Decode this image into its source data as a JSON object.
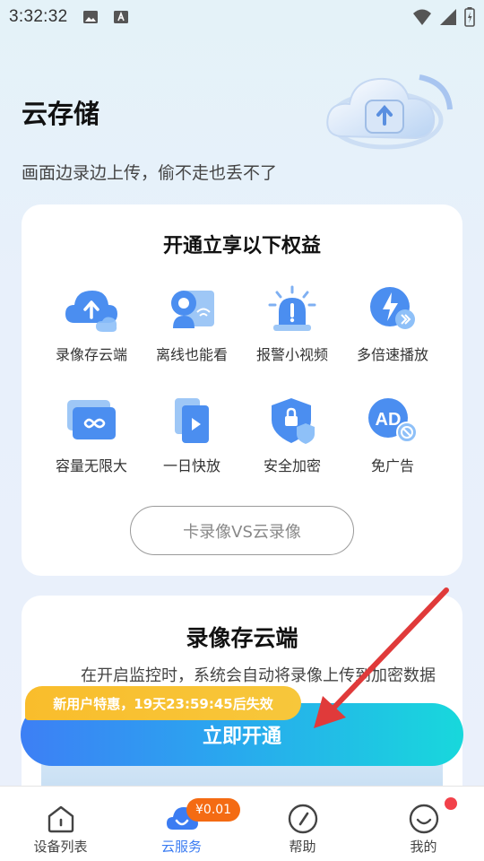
{
  "status_bar": {
    "time": "3:32:32"
  },
  "hero": {
    "title": "云存储",
    "subtitle": "画面边录边上传，偷不走也丢不了"
  },
  "benefits_card": {
    "title": "开通立享以下权益",
    "items": [
      {
        "label": "录像存云端",
        "icon": "cloud-upload-icon"
      },
      {
        "label": "离线也能看",
        "icon": "offline-camera-icon"
      },
      {
        "label": "报警小视频",
        "icon": "alarm-light-icon"
      },
      {
        "label": "多倍速播放",
        "icon": "fast-play-icon"
      },
      {
        "label": "容量无限大",
        "icon": "infinity-icon"
      },
      {
        "label": "一日快放",
        "icon": "quick-play-icon"
      },
      {
        "label": "安全加密",
        "icon": "shield-lock-icon"
      },
      {
        "label": "免广告",
        "icon": "no-ad-icon"
      }
    ],
    "compare_label": "卡录像VS云录像"
  },
  "detail_card": {
    "title": "录像存云端",
    "description": "在开启监控时，系统会自动将录像上传到加密数据安全"
  },
  "promo": {
    "tag": "新用户特惠，19天23:59:45后失效",
    "button": "立即开通"
  },
  "bottom_nav": {
    "items": [
      {
        "label": "设备列表"
      },
      {
        "label": "云服务"
      },
      {
        "label": "帮助"
      },
      {
        "label": "我的"
      }
    ],
    "price_badge": "¥0.01"
  },
  "colors": {
    "accent": "#3b7cf2",
    "badge": "#f46b13",
    "promo": "#f9bd2c",
    "arrow": "#e03a3a"
  }
}
